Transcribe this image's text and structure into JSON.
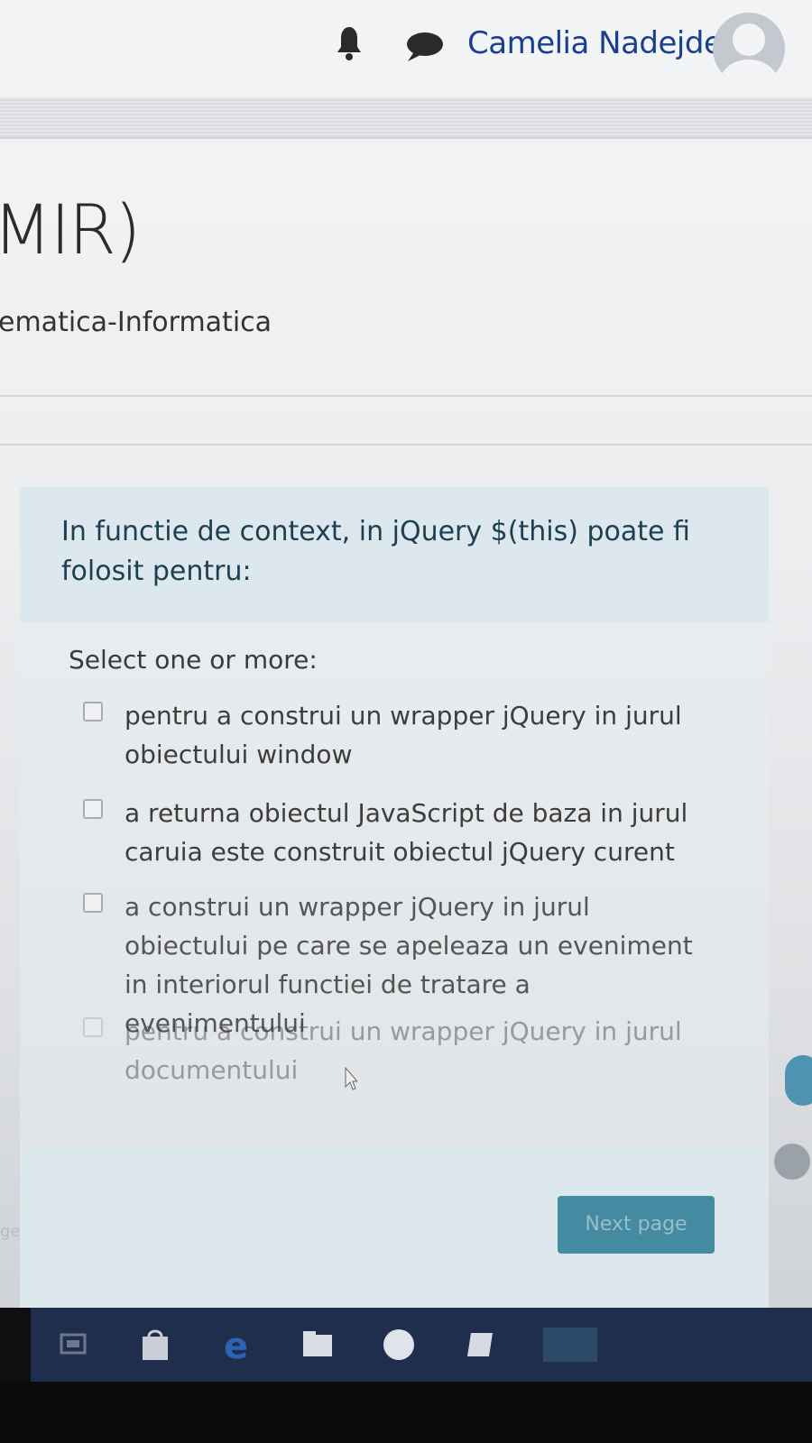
{
  "header": {
    "user_name": "Camelia Nadejde",
    "notification_icon": "bell-icon",
    "messages_icon": "chat-bubble-icon",
    "avatar_icon": "user-avatar-icon"
  },
  "course": {
    "title_fragment": "MIR)",
    "subtitle_fragment": "ematica-Informatica"
  },
  "question": {
    "text": "In functie de context, in jQuery $(this) poate fi folosit pentru:",
    "prompt": "Select one or more:",
    "options": [
      {
        "label": "pentru a construi un wrapper jQuery in jurul obiectului window",
        "checked": false
      },
      {
        "label": "a returna obiectul JavaScript de baza in jurul caruia este construit obiectul jQuery curent",
        "checked": false
      },
      {
        "label": "a construi un wrapper jQuery in jurul obiectului pe care se apeleaza un eveniment in interiorul functiei de tratare a evenimentului",
        "checked": false
      },
      {
        "label": "pentru a construi un wrapper jQuery in jurul documentului",
        "checked": false
      }
    ]
  },
  "navigation": {
    "next_label": "Next page",
    "left_fragment": "ge"
  },
  "taskbar": {
    "icons": [
      "task-view-icon",
      "store-bag-icon",
      "edge-browser-icon",
      "file-explorer-icon",
      "app-circle-icon",
      "app-diamond-icon",
      "active-app-icon"
    ]
  },
  "colors": {
    "accent": "#2a7a94",
    "question_bg": "#dce8ee",
    "user_name": "#1b3f8f",
    "taskbar": "#1e2e4c"
  }
}
